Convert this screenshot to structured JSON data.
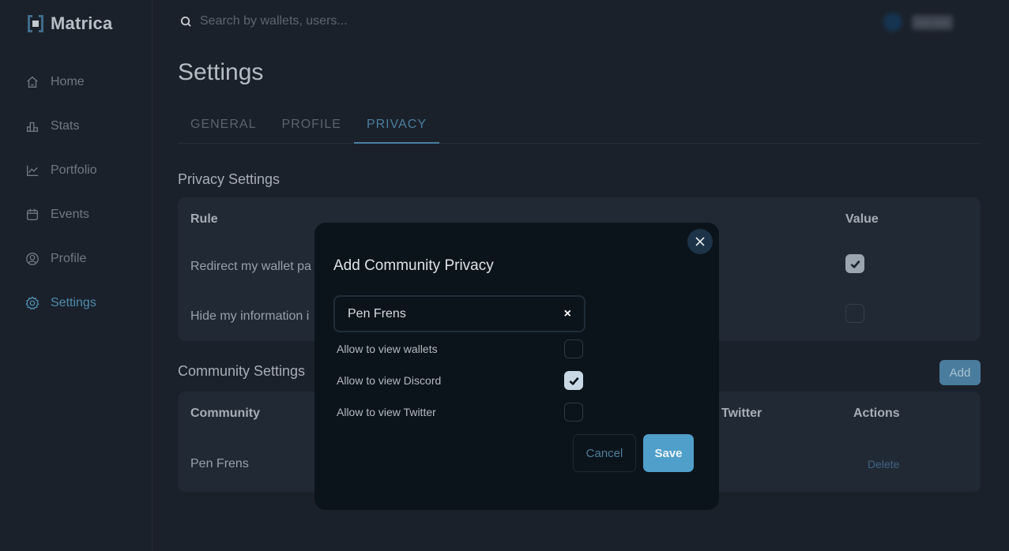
{
  "app": {
    "name": "Matrica"
  },
  "sidebar": {
    "items": [
      {
        "label": "Home",
        "icon": "home-icon",
        "active": false
      },
      {
        "label": "Stats",
        "icon": "stats-icon",
        "active": false
      },
      {
        "label": "Portfolio",
        "icon": "chart-line-icon",
        "active": false
      },
      {
        "label": "Events",
        "icon": "calendar-icon",
        "active": false
      },
      {
        "label": "Profile",
        "icon": "user-circle-icon",
        "active": false
      },
      {
        "label": "Settings",
        "icon": "gear-icon",
        "active": true
      }
    ]
  },
  "header": {
    "search_placeholder": "Search by wallets, users...",
    "user_name_blurred": "•••• ••••"
  },
  "page": {
    "title": "Settings",
    "tabs": [
      {
        "label": "GENERAL",
        "active": false
      },
      {
        "label": "PROFILE",
        "active": false
      },
      {
        "label": "PRIVACY",
        "active": true
      }
    ]
  },
  "privacy_settings": {
    "title": "Privacy Settings",
    "columns": {
      "rule": "Rule",
      "value": "Value"
    },
    "rows": [
      {
        "rule": "Redirect my wallet pa",
        "value": true
      },
      {
        "rule": "Hide my information i",
        "value": false
      }
    ]
  },
  "community_settings": {
    "title": "Community Settings",
    "add_label": "Add",
    "columns": {
      "community": "Community",
      "twitter": "Twitter",
      "actions": "Actions"
    },
    "rows": [
      {
        "community": "Pen Frens",
        "action": "Delete"
      }
    ]
  },
  "modal": {
    "title": "Add Community Privacy",
    "community_value": "Pen Frens",
    "clear_label": "×",
    "options": [
      {
        "label": "Allow to view wallets",
        "checked": false
      },
      {
        "label": "Allow to view Discord",
        "checked": true
      },
      {
        "label": "Allow to view Twitter",
        "checked": false
      }
    ],
    "cancel_label": "Cancel",
    "save_label": "Save"
  },
  "colors": {
    "accent": "#4b7ea0",
    "save_button": "#4f9fca",
    "background": "#1b212b",
    "card": "#212935",
    "modal": "#0c141b"
  }
}
